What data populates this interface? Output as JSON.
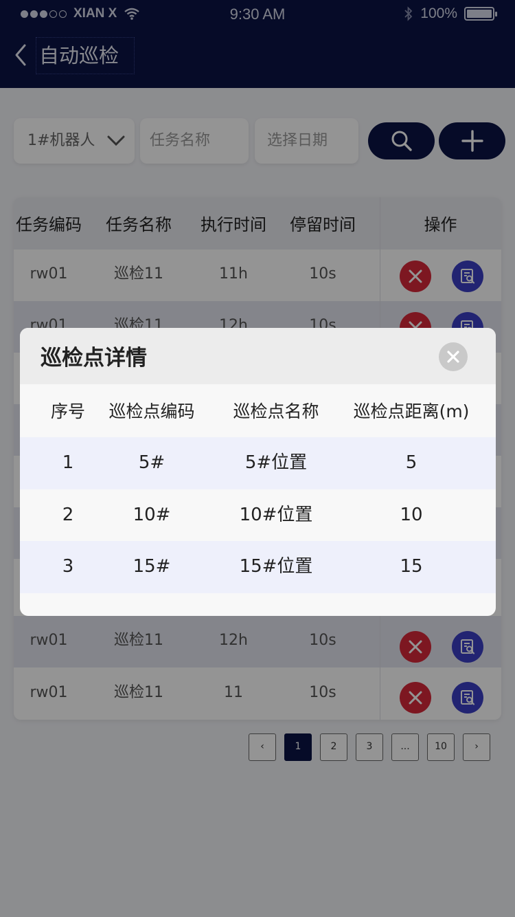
{
  "status_bar": {
    "carrier": "XIAN X",
    "time": "9:30 AM",
    "battery": "100%",
    "signal_bars_filled": 3,
    "signal_bars_total": 5
  },
  "nav": {
    "title": "自动巡检"
  },
  "filters": {
    "robot_value": "1#机器人",
    "task_name_placeholder": "任务名称",
    "date_placeholder": "选择日期"
  },
  "task_table": {
    "headers": [
      "任务编码",
      "任务名称",
      "执行时间",
      "停留时间",
      "操作"
    ],
    "rows": [
      {
        "code": "rw01",
        "name": "巡检11",
        "exec_time": "11h",
        "stay_time": "10s"
      },
      {
        "code": "rw01",
        "name": "巡检11",
        "exec_time": "12h",
        "stay_time": "10s"
      },
      {
        "code": "rw01",
        "name": "巡检11",
        "exec_time": "12h",
        "stay_time": "10s"
      },
      {
        "code": "rw01",
        "name": "巡检11",
        "exec_time": "11",
        "stay_time": "10s"
      }
    ]
  },
  "pagination": {
    "prev": "‹",
    "pages": [
      "1",
      "2",
      "3",
      "...",
      "10"
    ],
    "current": "1",
    "next": "›"
  },
  "modal": {
    "title": "巡检点详情",
    "headers": [
      "序号",
      "巡检点编码",
      "巡检点名称",
      "巡检点距离(m)"
    ],
    "rows": [
      {
        "index": "1",
        "code": "5#",
        "name": "5#位置",
        "distance": "5"
      },
      {
        "index": "2",
        "code": "10#",
        "name": "10#位置",
        "distance": "10"
      },
      {
        "index": "3",
        "code": "15#",
        "name": "15#位置",
        "distance": "15"
      }
    ]
  },
  "colors": {
    "nav_bg": "#0b1446",
    "delete": "#d8283a",
    "view": "#3b3fc4",
    "modal_row_tint": "#eef0fb"
  },
  "icons": [
    "back-arrow-icon",
    "wifi-icon",
    "bluetooth-icon",
    "battery-icon",
    "chevron-down-icon",
    "search-icon",
    "plus-icon",
    "delete-icon",
    "view-detail-icon",
    "close-icon"
  ]
}
